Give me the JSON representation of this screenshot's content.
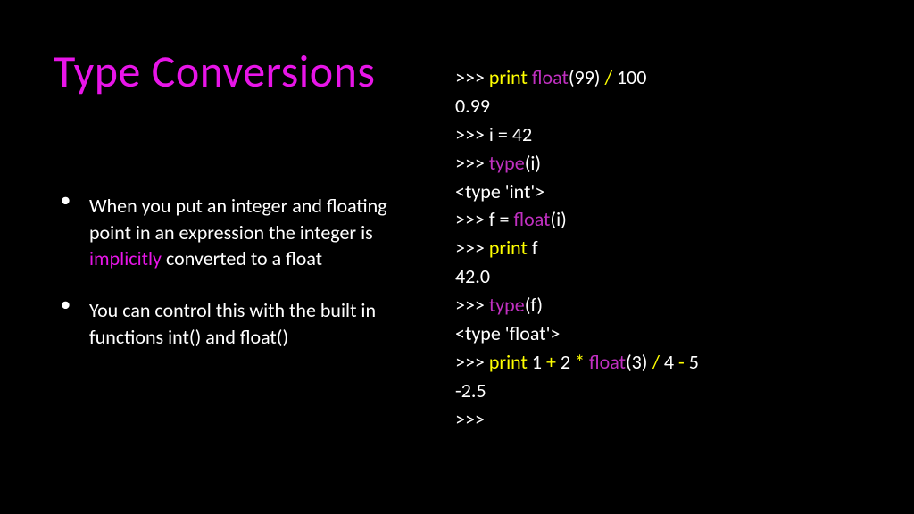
{
  "title": "Type Conversions",
  "bullets": [
    {
      "pre": "When you put an integer and floating point in an expression the integer is ",
      "highlight": "implicitly",
      "post": " converted to a float"
    },
    {
      "pre": "You can control this with the built in functions int() and float()",
      "highlight": "",
      "post": ""
    }
  ],
  "code": {
    "l1_a": ">>> ",
    "l1_b": "print",
    "l1_c": " ",
    "l1_d": "float",
    "l1_e": "(99) ",
    "l1_f": "/",
    "l1_g": " 100",
    "l2": "0.99",
    "l3": ">>> i = 42",
    "l4_a": ">>> ",
    "l4_b": "type",
    "l4_c": "(i)",
    "l5": "<type 'int'>",
    "l6_a": ">>> f = ",
    "l6_b": "float",
    "l6_c": "(i)",
    "l7_a": ">>> ",
    "l7_b": "print",
    "l7_c": " f",
    "l8": "42.0",
    "l9_a": ">>> ",
    "l9_b": "type",
    "l9_c": "(f)",
    "l10": "<type 'float'>",
    "l11_a": ">>> ",
    "l11_b": "print",
    "l11_c": " 1 ",
    "l11_d": "+",
    "l11_e": " 2 ",
    "l11_f": "*",
    "l11_g": " ",
    "l11_h": "float",
    "l11_i": "(3) ",
    "l11_j": "/",
    "l11_k": " 4 ",
    "l11_l": "-",
    "l11_m": " 5",
    "l12": "-2.5",
    "l13": ">>> "
  }
}
